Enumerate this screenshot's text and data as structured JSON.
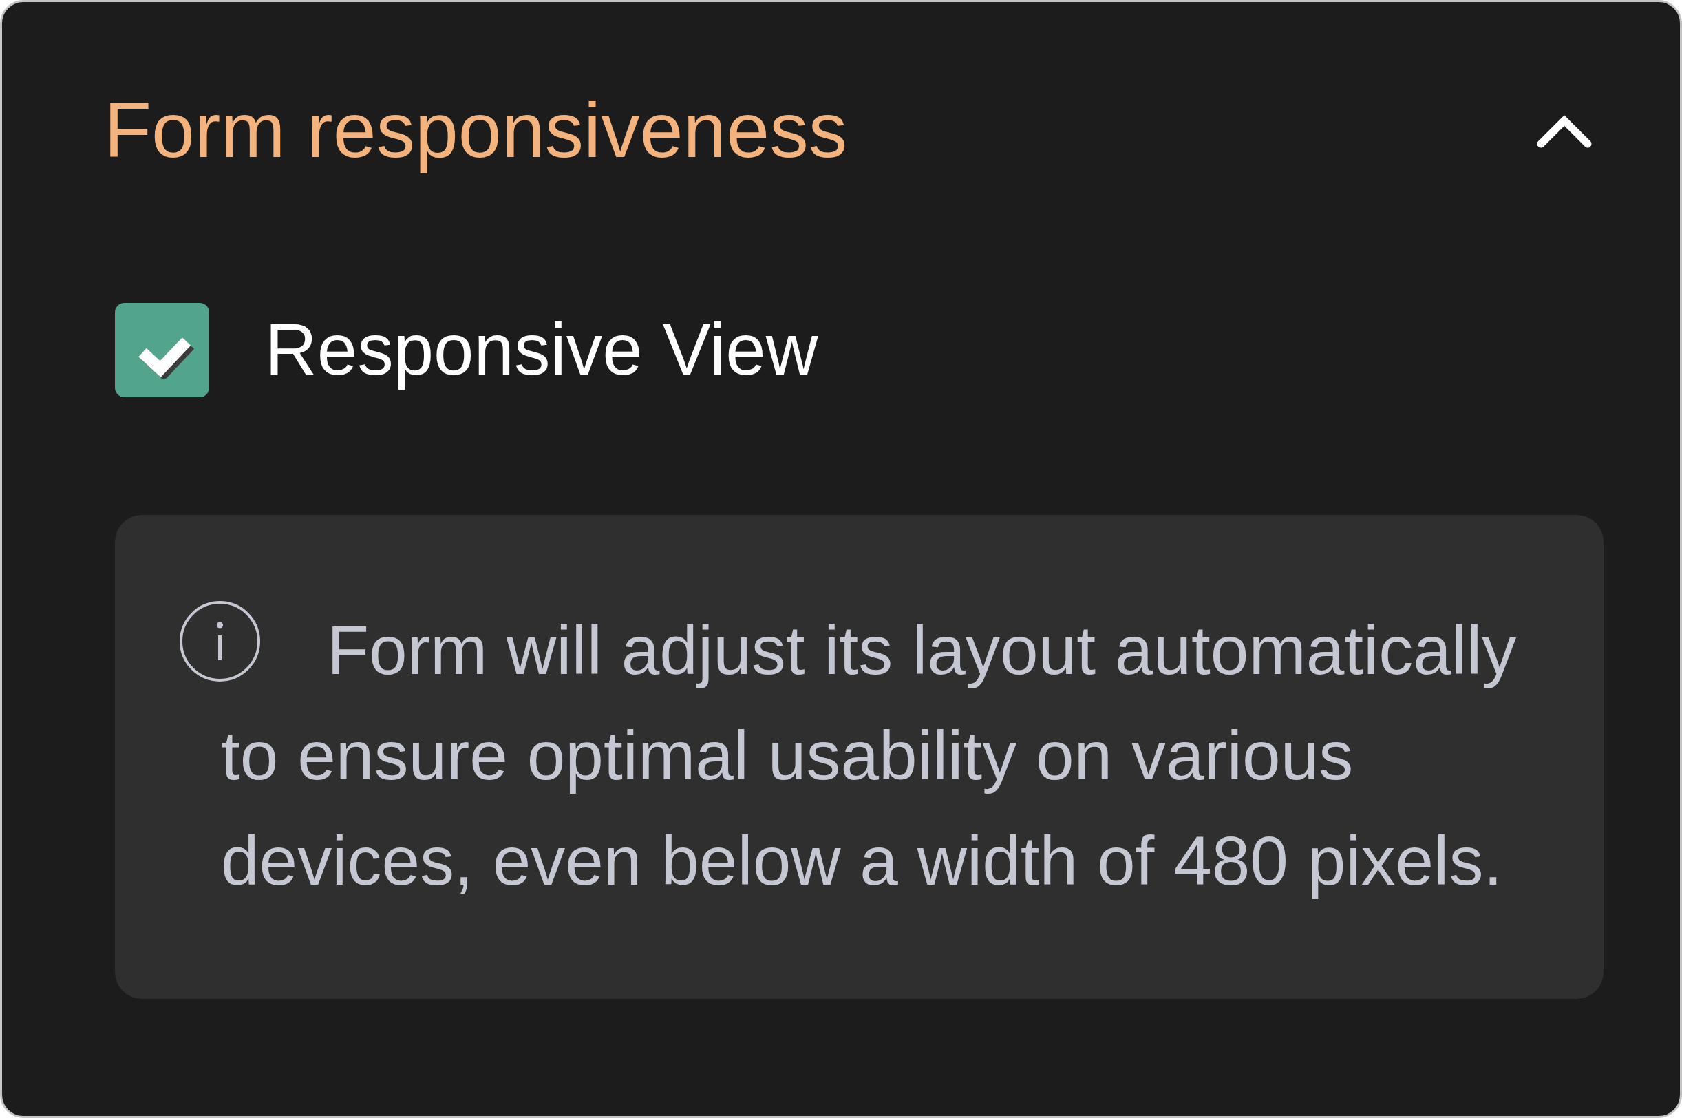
{
  "panel": {
    "title": "Form responsiveness",
    "expanded": true
  },
  "option": {
    "label": "Responsive View",
    "checked": true
  },
  "info": {
    "text": "Form will adjust its layout automatically to ensure optimal usability on various devices, even below a width of 480 pixels."
  }
}
